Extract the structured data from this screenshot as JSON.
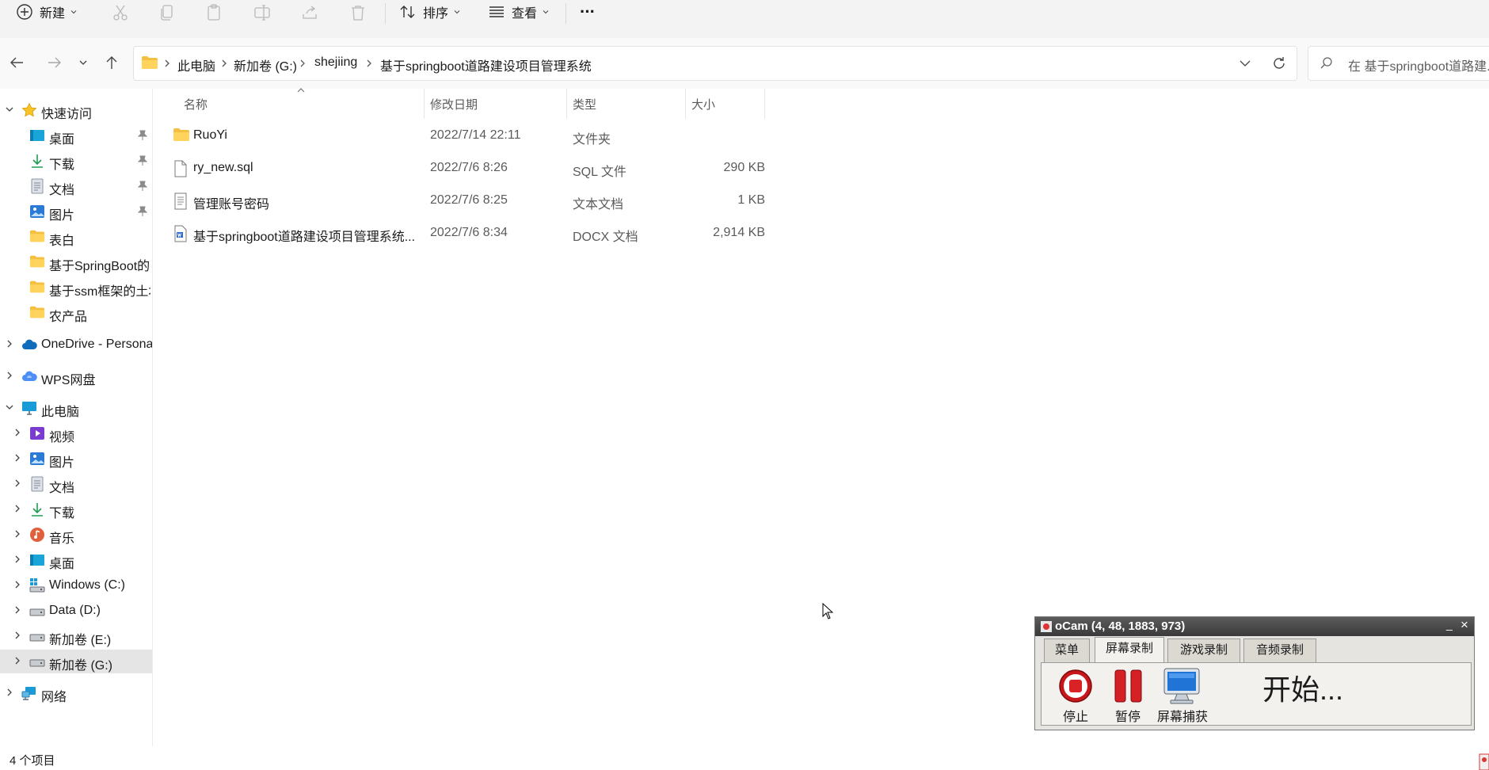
{
  "toolbar": {
    "new_label": "新建",
    "sort_label": "排序",
    "view_label": "查看",
    "more_label": "···"
  },
  "address": {
    "breadcrumbs": [
      "此电脑",
      "新加卷 (G:)",
      "shejiing",
      "基于springboot道路建设项目管理系统"
    ],
    "search_placeholder": "在 基于springboot道路建..."
  },
  "sidebar": {
    "quick_access_label": "快速访问",
    "quick_items": [
      {
        "label": "桌面",
        "icon": "desktop-icon",
        "pinned": true
      },
      {
        "label": "下载",
        "icon": "download-icon",
        "pinned": true
      },
      {
        "label": "文档",
        "icon": "document-icon",
        "pinned": true
      },
      {
        "label": "图片",
        "icon": "picture-icon",
        "pinned": true
      },
      {
        "label": "表白",
        "icon": "folder-icon",
        "pinned": false
      },
      {
        "label": "基于SpringBoot的",
        "icon": "folder-icon",
        "pinned": false
      },
      {
        "label": "基于ssm框架的土地",
        "icon": "folder-icon",
        "pinned": false
      },
      {
        "label": "农产品",
        "icon": "folder-icon",
        "pinned": false
      }
    ],
    "onedrive_label": "OneDrive - Persona",
    "wps_label": "WPS网盘",
    "this_pc_label": "此电脑",
    "pc_items": [
      {
        "label": "视频",
        "icon": "video-icon"
      },
      {
        "label": "图片",
        "icon": "picture-icon"
      },
      {
        "label": "文档",
        "icon": "document-icon"
      },
      {
        "label": "下载",
        "icon": "download-icon"
      },
      {
        "label": "音乐",
        "icon": "music-icon"
      },
      {
        "label": "桌面",
        "icon": "desktop-icon"
      },
      {
        "label": "Windows (C:)",
        "icon": "drive-icon"
      },
      {
        "label": "Data (D:)",
        "icon": "drive-icon"
      },
      {
        "label": "新加卷 (E:)",
        "icon": "drive-icon"
      },
      {
        "label": "新加卷 (G:)",
        "icon": "drive-icon",
        "selected": true
      }
    ],
    "network_label": "网络"
  },
  "file_list": {
    "columns": [
      "名称",
      "修改日期",
      "类型",
      "大小"
    ],
    "rows": [
      {
        "name": "RuoYi",
        "date": "2022/7/14 22:11",
        "type": "文件夹",
        "size": "",
        "icon": "folder-icon"
      },
      {
        "name": "ry_new.sql",
        "date": "2022/7/6 8:26",
        "type": "SQL 文件",
        "size": "290 KB",
        "icon": "file-icon"
      },
      {
        "name": "管理账号密码",
        "date": "2022/7/6 8:25",
        "type": "文本文档",
        "size": "1 KB",
        "icon": "text-file-icon"
      },
      {
        "name": "基于springboot道路建设项目管理系统...",
        "date": "2022/7/6 8:34",
        "type": "DOCX 文档",
        "size": "2,914 KB",
        "icon": "docx-icon"
      }
    ]
  },
  "status_bar": {
    "item_count": "4 个项目"
  },
  "ocam": {
    "title": "oCam (4, 48, 1883, 973)",
    "minimize": "_",
    "close": "×",
    "tabs": [
      "菜单",
      "屏幕录制",
      "游戏录制",
      "音频录制"
    ],
    "active_tab": "屏幕录制",
    "stop_label": "停止",
    "pause_label": "暂停",
    "capture_label": "屏幕捕获",
    "status_text": "开始..."
  }
}
